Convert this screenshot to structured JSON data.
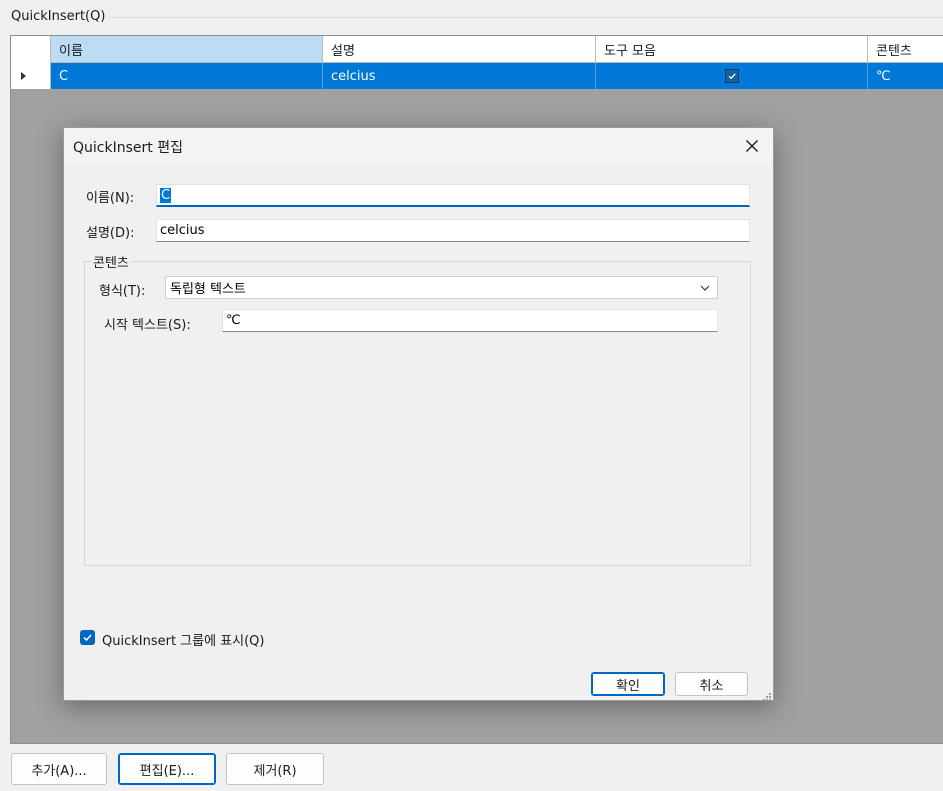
{
  "window": {
    "group_label": "QuickInsert(Q)"
  },
  "grid": {
    "columns": [
      "이름",
      "설명",
      "도구 모음",
      "콘텐츠"
    ],
    "rows": [
      {
        "name": "C",
        "description": "celcius",
        "toolbar": true,
        "content": "℃"
      }
    ]
  },
  "footer": {
    "add_label": "추가(A)...",
    "edit_label": "편집(E)...",
    "remove_label": "제거(R)"
  },
  "dialog": {
    "title": "QuickInsert 편집",
    "name_label": "이름(N):",
    "name_value": "C",
    "description_label": "설명(D):",
    "description_value": "celcius",
    "content_group_label": "콘텐츠",
    "format_label": "형식(T):",
    "format_value": "독립형 텍스트",
    "start_text_label": "시작 텍스트(S):",
    "start_text_value": "℃",
    "show_in_group_label": "QuickInsert 그룹에 표시(Q)",
    "show_in_group_checked": true,
    "ok_label": "확인",
    "cancel_label": "취소"
  },
  "colors": {
    "selection": "#0078d7",
    "accent": "#0067c0",
    "header_selected": "#bcdcf4",
    "grid_background": "#a0a0a0"
  },
  "icons": {
    "close": "close-icon",
    "dropdown": "chevron-down-icon",
    "checkbox": "checkmark-icon",
    "row_indicator": "row-indicator-icon"
  }
}
